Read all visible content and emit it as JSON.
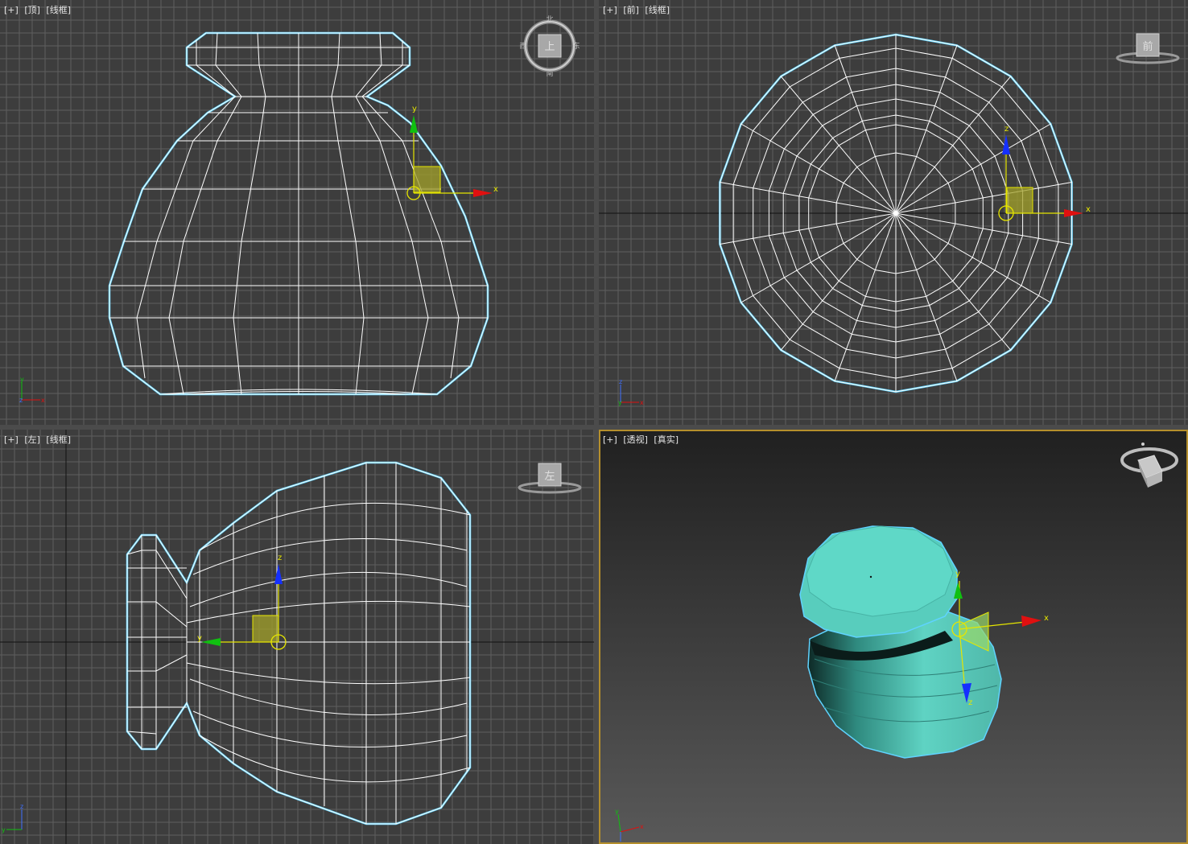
{
  "viewports": {
    "top": {
      "plus": "[+]",
      "view": "[顶]",
      "mode": "[线框]"
    },
    "front": {
      "plus": "[+]",
      "view": "[前]",
      "mode": "[线框]"
    },
    "left": {
      "plus": "[+]",
      "view": "[左]",
      "mode": "[线框]"
    },
    "perspective": {
      "plus": "[+]",
      "view": "[透视]",
      "mode": "[真实]"
    }
  },
  "viewcube": {
    "top": {
      "face": "上",
      "north": "北",
      "south": "南",
      "west": "西",
      "east": "东"
    },
    "front": {
      "face": "前"
    },
    "left": {
      "face": "左"
    }
  },
  "gizmo_axes": {
    "x": "x",
    "y": "y",
    "z": "z"
  },
  "colors": {
    "viewport_bg": "#3d3d3d",
    "grid": "#5e5e5e",
    "wire": "#ffffff",
    "outline": "#5fd3ff",
    "object_fill": "#5ccfc0",
    "axis_x": "#e01010",
    "axis_y": "#10c010",
    "axis_z": "#1530ff",
    "gizmo": "#e6e600",
    "active_border": "#b58f2c"
  }
}
